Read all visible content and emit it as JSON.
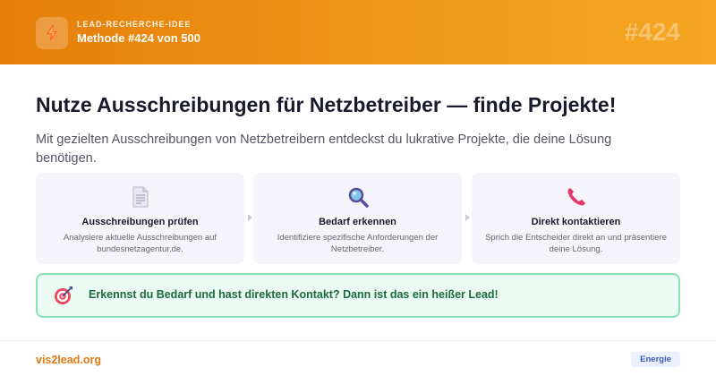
{
  "header": {
    "kicker": "LEAD-RECHERCHE-IDEE",
    "subtitle": "Methode #424 von 500",
    "number": "#424",
    "logo_icon": "lightning-icon"
  },
  "main": {
    "title": "Nutze Ausschreibungen für Netzbetreiber — finde Projekte!",
    "description": "Mit gezielten Ausschreibungen von Netzbetreibern entdeckst du lukrative Projekte, die deine Lösung benötigen."
  },
  "steps": [
    {
      "icon": "document-icon",
      "title": "Ausschreibungen prüfen",
      "text": "Analysiere aktuelle Ausschreibungen auf bundesnetzagentur.de."
    },
    {
      "icon": "magnifier-icon",
      "title": "Bedarf erkennen",
      "text": "Identifiziere spezifische Anforderungen der Netzbetreiber."
    },
    {
      "icon": "phone-icon",
      "title": "Direkt kontaktieren",
      "text": "Sprich die Entscheider direkt an und präsentiere deine Lösung."
    }
  ],
  "callout": {
    "icon": "target-icon",
    "text": "Erkennst du Bedarf und hast direkten Kontakt? Dann ist das ein heißer Lead!"
  },
  "footer": {
    "brand": "vis2lead.org",
    "tag": "Energie"
  },
  "colors": {
    "header_start": "#e67e0a",
    "header_end": "#f5a623",
    "callout_border": "#86e3b0",
    "callout_text": "#1a6b3d",
    "brand": "#e27a12"
  }
}
